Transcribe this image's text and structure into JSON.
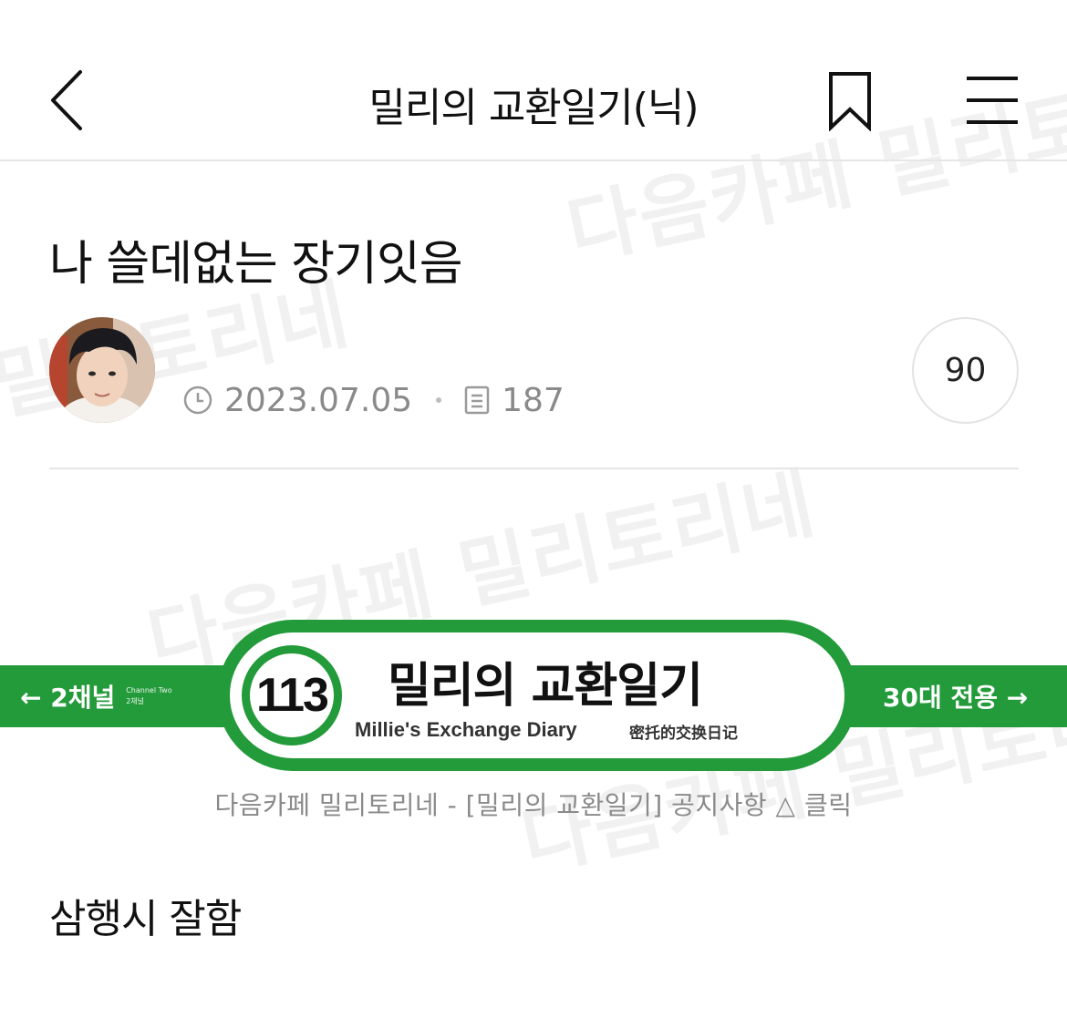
{
  "header": {
    "title": "밀리의 교환일기(닉)"
  },
  "post": {
    "title": "나 쓸데없는 장기잇음",
    "date": "2023.07.05",
    "views": "187",
    "comment_count": "90"
  },
  "banner": {
    "number": "113",
    "title": "밀리의 교환일기",
    "subtitle_en": "Millie's Exchange Diary",
    "subtitle_cn": "密托的交换日记",
    "left_label": "← 2채널",
    "left_small_1": "Channel Two",
    "left_small_2": "2채널",
    "right_label": "30대 전용 →",
    "caption": "다음카페 밀리토리네 - [밀리의 교환일기] 공지사항 △ 클릭"
  },
  "body": {
    "text": "삼행시 잘함"
  },
  "watermarks": [
    "다음카페 밀리토리네",
    "다음카페 밀리토리네",
    "밀리토리네",
    "다음카페 밀리토리네"
  ],
  "colors": {
    "accent": "#239b3a",
    "meta": "#8a8a8a"
  }
}
